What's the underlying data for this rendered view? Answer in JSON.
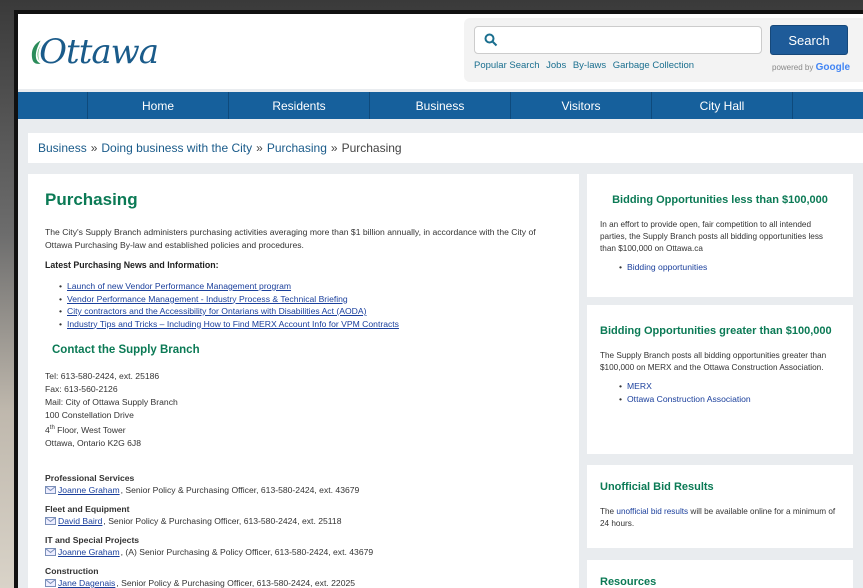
{
  "header": {
    "logo_text": "Ottawa",
    "search": {
      "placeholder": "",
      "button_label": "Search",
      "popular_label": "Popular Search",
      "popular_links": [
        "Jobs",
        "By-laws",
        "Garbage Collection"
      ],
      "powered_by": "powered by",
      "powered_brand": "Google"
    }
  },
  "nav": {
    "items": [
      "Home",
      "Residents",
      "Business",
      "Visitors",
      "City Hall"
    ]
  },
  "breadcrumb": {
    "items": [
      "Business",
      "Doing business with the City",
      "Purchasing"
    ],
    "separator": "»",
    "current": "Purchasing"
  },
  "main": {
    "title": "Purchasing",
    "intro": "The City's Supply Branch administers purchasing activities averaging more than $1 billion annually, in accordance with the City of Ottawa Purchasing By-law and established policies and procedures.",
    "news_heading": "Latest Purchasing News and Information:",
    "news_links": [
      "Launch of new Vendor Performance Management program",
      "Vendor Performance Management - Industry Process & Technical Briefing",
      "City contractors and the Accessibility for Ontarians with Disabilities Act (AODA)",
      "Industry Tips and Tricks – Including How to Find MERX Account Info for VPM Contracts"
    ],
    "contact_heading": "Contact the Supply Branch",
    "contact": {
      "tel": "Tel: 613-580-2424, ext. 25186",
      "fax": "Fax: 613-560-2126",
      "mail": "Mail: City of Ottawa Supply Branch",
      "address1": "100 Constellation Drive",
      "floor_num": "4",
      "floor_sup": "th",
      "floor_rest": " Floor, West Tower",
      "address3": "Ottawa, Ontario  K2G 6J8"
    },
    "staff": [
      {
        "heading": "Professional Services",
        "name": "Joanne Graham",
        "detail": ", Senior Policy & Purchasing Officer, 613-580-2424, ext. 43679"
      },
      {
        "heading": "Fleet and Equipment",
        "name": "David Baird",
        "detail": ", Senior Policy & Purchasing Officer, 613-580-2424, ext. 25118"
      },
      {
        "heading": "IT and Special Projects",
        "name": "Joanne Graham",
        "detail": ", (A) Senior Purchasing & Policy Officer, 613-580-2424, ext. 43679"
      },
      {
        "heading": "Construction",
        "name": "Jane Dagenais",
        "detail": ", Senior Policy & Purchasing Officer, 613-580-2424, ext. 22025"
      }
    ]
  },
  "sidebar": {
    "boxes": [
      {
        "title": "Bidding Opportunities less than $100,000",
        "text": "In an effort to provide open, fair competition to all intended parties, the Supply Branch posts all bidding opportunities less than $100,000 on Ottawa.ca",
        "links": [
          "Bidding opportunities"
        ]
      },
      {
        "title": "Bidding Opportunities greater than $100,000",
        "text": "The Supply Branch posts all bidding opportunities greater than $100,000 on MERX and the Ottawa Construction Association.",
        "links": [
          "MERX",
          "Ottawa Construction Association"
        ]
      },
      {
        "title": "Unofficial Bid Results",
        "text_before": "The ",
        "text_link": "unofficial bid results",
        "text_after": " will be available online for a minimum of 24 hours."
      },
      {
        "title": "Resources"
      }
    ]
  },
  "colors": {
    "nav": "#16609c",
    "heading_green": "#0b7a55",
    "link_blue": "#1a3f9c",
    "search_button": "#1e5b99"
  },
  "icons": [
    "ottawa-logo-icon",
    "search-icon",
    "mail-icon"
  ]
}
